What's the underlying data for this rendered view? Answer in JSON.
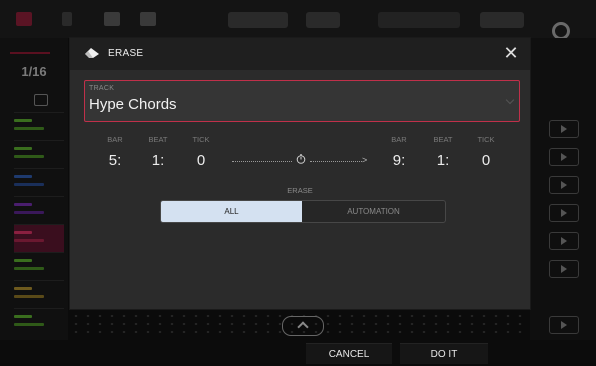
{
  "background": {
    "resolution": "1/16",
    "scroll_icon": "chevron-up-icon",
    "play_buttons": 7
  },
  "modal": {
    "title": "ERASE",
    "title_icon": "eraser-icon",
    "close_glyph": "✕",
    "track": {
      "label": "TRACK",
      "value": "Hype Chords"
    },
    "start": {
      "bar_label": "BAR",
      "beat_label": "BEAT",
      "tick_label": "TICK",
      "bar": "5:",
      "beat": "1:",
      "tick": "0"
    },
    "end": {
      "bar_label": "BAR",
      "beat_label": "BEAT",
      "tick_label": "TICK",
      "bar": "9:",
      "beat": "1:",
      "tick": "0"
    },
    "erase": {
      "label": "ERASE",
      "options": [
        "ALL",
        "AUTOMATION"
      ],
      "selected": "ALL"
    }
  },
  "footer": {
    "cancel": "CANCEL",
    "do_it": "DO IT"
  },
  "colors": {
    "accent_red": "#c0304a",
    "selected_option": "#d4e1f1",
    "modal_bg": "#2b2b2b"
  }
}
